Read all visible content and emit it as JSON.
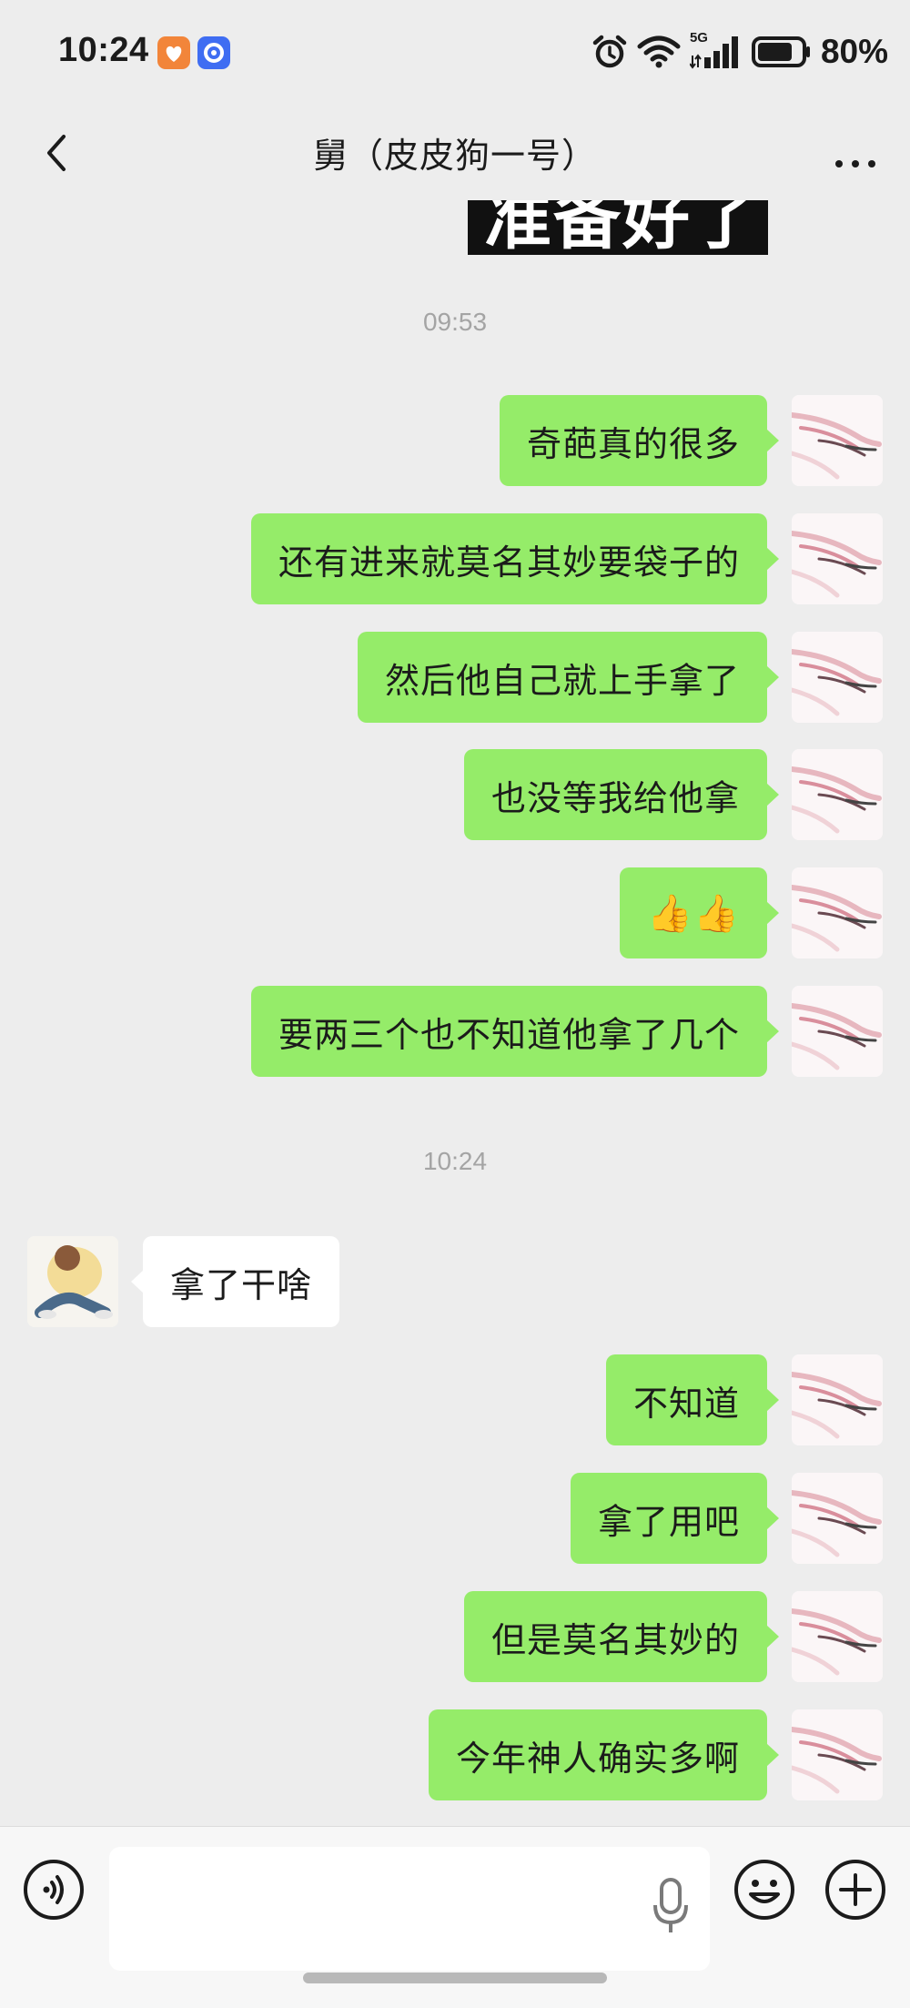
{
  "status_bar": {
    "time": "10:24",
    "battery_percent": "80%",
    "network": "5G",
    "battery_level": 0.8,
    "icons": [
      "alarm-icon",
      "wifi-icon",
      "signal-icon",
      "battery-icon"
    ]
  },
  "header": {
    "title": "舅（皮皮狗一号）",
    "back_icon": "chevron-left-icon",
    "more_icon": "more-icon"
  },
  "sticker_text": "准备好了",
  "messages": [
    {
      "type": "time",
      "text": "09:53"
    },
    {
      "type": "msg",
      "from": "me",
      "text": "奇葩真的很多"
    },
    {
      "type": "msg",
      "from": "me",
      "text": "还有进来就莫名其妙要袋子的"
    },
    {
      "type": "msg",
      "from": "me",
      "text": "然后他自己就上手拿了"
    },
    {
      "type": "msg",
      "from": "me",
      "text": "也没等我给他拿"
    },
    {
      "type": "msg",
      "from": "me",
      "text": "👍👍"
    },
    {
      "type": "msg",
      "from": "me",
      "text": "要两三个也不知道他拿了几个"
    },
    {
      "type": "time",
      "text": "10:24"
    },
    {
      "type": "msg",
      "from": "peer",
      "text": "拿了干啥"
    },
    {
      "type": "msg",
      "from": "me",
      "text": "不知道"
    },
    {
      "type": "msg",
      "from": "me",
      "text": "拿了用吧"
    },
    {
      "type": "msg",
      "from": "me",
      "text": "但是莫名其妙的"
    },
    {
      "type": "msg",
      "from": "me",
      "text": "今年神人确实多啊"
    }
  ],
  "input_bar": {
    "placeholder": "",
    "icons": [
      "voice-icon",
      "mic-icon",
      "emoji-icon",
      "plus-icon"
    ]
  },
  "colors": {
    "background": "#ededed",
    "my_bubble": "#95ec69",
    "peer_bubble": "#ffffff",
    "timestamp": "#a4a4a4"
  }
}
